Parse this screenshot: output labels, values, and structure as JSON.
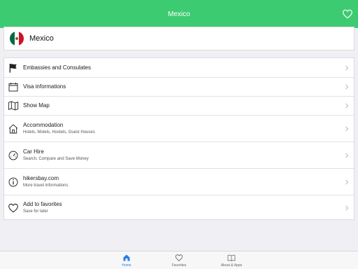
{
  "header": {
    "title": "Mexico"
  },
  "country": {
    "name": "Mexico",
    "flag_icon": "mexico-flag-icon"
  },
  "menu": [
    {
      "title": "Embassies and Consulates",
      "subtitle": "",
      "icon": "flag-icon"
    },
    {
      "title": "Visa informations",
      "subtitle": "",
      "icon": "calendar-icon"
    },
    {
      "title": "Show Map",
      "subtitle": "",
      "icon": "map-icon"
    },
    {
      "title": "Accommodation",
      "subtitle": "Hotels, Motels, Hostels, Guest Houses",
      "icon": "house-icon"
    },
    {
      "title": "Car Hire",
      "subtitle": "Search, Compare and Save Money",
      "icon": "speedometer-icon"
    },
    {
      "title": "hikersbay.com",
      "subtitle": "More travel informations",
      "icon": "info-icon"
    },
    {
      "title": "Add to favorites",
      "subtitle": "Save for later",
      "icon": "heart-icon"
    }
  ],
  "tabs": [
    {
      "label": "Home",
      "icon": "home-icon",
      "active": true
    },
    {
      "label": "Favorites",
      "icon": "heart-icon",
      "active": false
    },
    {
      "label": "About & Apps",
      "icon": "book-icon",
      "active": false
    }
  ],
  "colors": {
    "accent": "#3dcb71",
    "active_tab": "#2b7de9",
    "background": "#efeff4"
  }
}
